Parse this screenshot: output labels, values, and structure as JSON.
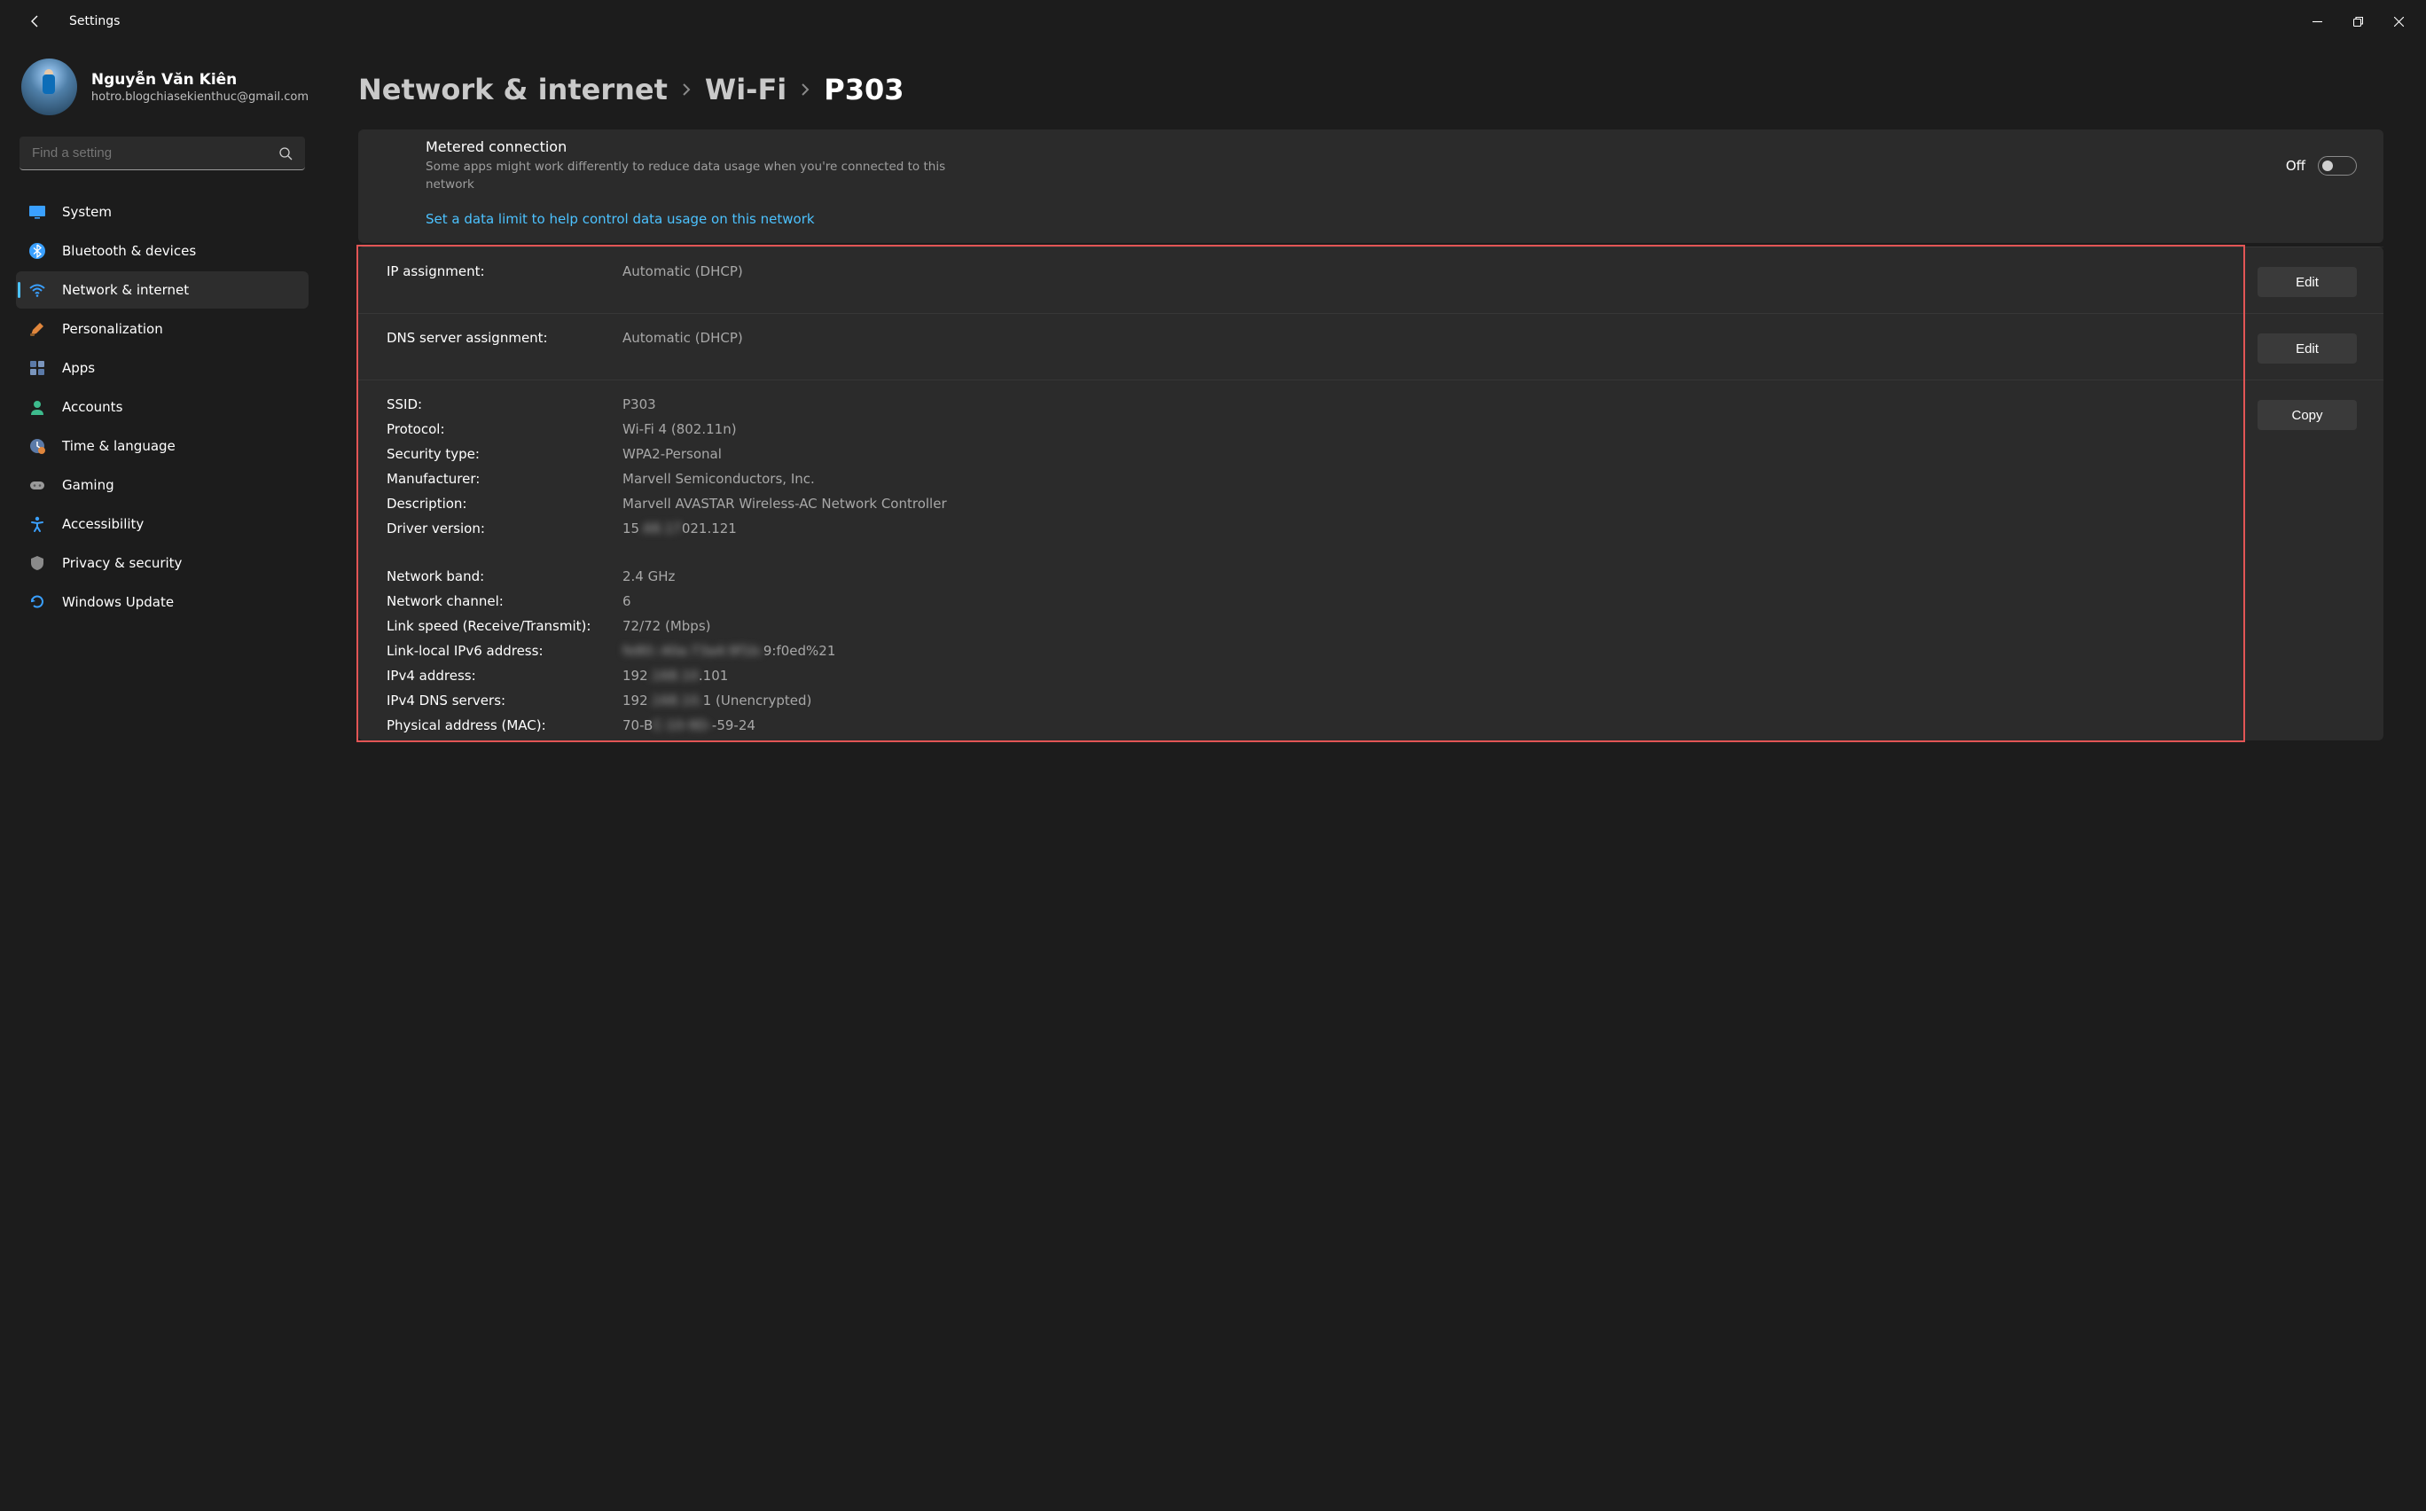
{
  "window": {
    "title": "Settings"
  },
  "user": {
    "name": "Nguyễn Văn Kiên",
    "email": "hotro.blogchiasekienthuc@gmail.com"
  },
  "search": {
    "placeholder": "Find a setting"
  },
  "nav": [
    {
      "key": "system",
      "label": "System",
      "icon": "monitor",
      "color": "#3aa0ff"
    },
    {
      "key": "bluetooth",
      "label": "Bluetooth & devices",
      "icon": "bluetooth",
      "color": "#3aa0ff"
    },
    {
      "key": "network",
      "label": "Network & internet",
      "icon": "wifi",
      "color": "#3aa0ff",
      "active": true
    },
    {
      "key": "personalization",
      "label": "Personalization",
      "icon": "brush",
      "color": "#e0863c"
    },
    {
      "key": "apps",
      "label": "Apps",
      "icon": "apps",
      "color": "#5b7aa8"
    },
    {
      "key": "accounts",
      "label": "Accounts",
      "icon": "person",
      "color": "#3dbb8d"
    },
    {
      "key": "time",
      "label": "Time & language",
      "icon": "clock",
      "color": "#5b7aa8"
    },
    {
      "key": "gaming",
      "label": "Gaming",
      "icon": "gamepad",
      "color": "#9a9a9a"
    },
    {
      "key": "accessibility",
      "label": "Accessibility",
      "icon": "accessibility",
      "color": "#3aa0ff"
    },
    {
      "key": "privacy",
      "label": "Privacy & security",
      "icon": "shield",
      "color": "#8a8a8a"
    },
    {
      "key": "update",
      "label": "Windows Update",
      "icon": "update",
      "color": "#3aa0ff"
    }
  ],
  "breadcrumb": {
    "root": "Network & internet",
    "mid": "Wi-Fi",
    "leaf": "P303"
  },
  "metered": {
    "title": "Metered connection",
    "subtitle": "Some apps might work differently to reduce data usage when you're connected to this network",
    "state_label": "Off",
    "state": false
  },
  "datalimit_link": "Set a data limit to help control data usage on this network",
  "buttons": {
    "edit": "Edit",
    "copy": "Copy"
  },
  "ip_assignment": {
    "label": "IP assignment:",
    "value": "Automatic (DHCP)"
  },
  "dns_assignment": {
    "label": "DNS server assignment:",
    "value": "Automatic (DHCP)"
  },
  "props": {
    "ssid_k": "SSID:",
    "ssid_v": "P303",
    "protocol_k": "Protocol:",
    "protocol_v": "Wi-Fi 4 (802.11n)",
    "security_k": "Security type:",
    "security_v": "WPA2-Personal",
    "manufacturer_k": "Manufacturer:",
    "manufacturer_v": "Marvell Semiconductors, Inc.",
    "description_k": "Description:",
    "description_v": "Marvell AVASTAR Wireless-AC Network Controller",
    "driver_k": "Driver version:",
    "driver_v_prefix": "15",
    "driver_v_blur": ".68.17",
    "driver_v_suffix": "021.121",
    "band_k": "Network band:",
    "band_v": "2.4 GHz",
    "channel_k": "Network channel:",
    "channel_v": "6",
    "link_k": "Link speed (Receive/Transmit):",
    "link_v": "72/72 (Mbps)",
    "ipv6ll_k": "Link-local IPv6 address:",
    "ipv6ll_v_blur": "fe80::40a:73a4:9f1b:",
    "ipv6ll_v_suffix": "9:f0ed%21",
    "ipv4_k": "IPv4 address:",
    "ipv4_v_prefix": "192",
    "ipv4_v_blur": ".168.10",
    "ipv4_v_suffix": ".101",
    "dns4_k": "IPv4 DNS servers:",
    "dns4_v_prefix": "192",
    "dns4_v_blur": ".168.10.",
    "dns4_v_suffix": "1 (Unencrypted)",
    "mac_k": "Physical address (MAC):",
    "mac_v_prefix": "70-B",
    "mac_v_blur": "C-10-9D-",
    "mac_v_suffix": "-59-24"
  }
}
